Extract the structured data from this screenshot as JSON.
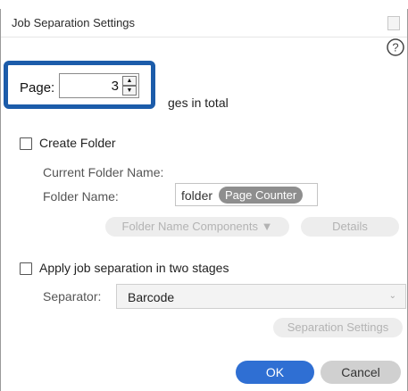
{
  "dialog": {
    "title": "Job Separation Settings",
    "help_icon": "question-circle-icon",
    "close_icon": "close-icon"
  },
  "page_spinner": {
    "label": "Page:",
    "value": "3",
    "up_icon": "triangle-up-icon",
    "down_icon": "triangle-down-icon"
  },
  "pages_total_row": {
    "label_visible": "ges in total"
  },
  "create_folder": {
    "label": "Create Folder",
    "checked": false,
    "current_folder_name_label": "Current Folder Name:",
    "folder_name_label": "Folder Name:",
    "folder_name_text": "folder",
    "folder_name_token": "Page Counter",
    "components_button": "Folder Name Components ▼",
    "details_button": "Details"
  },
  "two_stage": {
    "label": "Apply job separation in two stages",
    "checked": false,
    "separator_label": "Separator:",
    "separator_value": "Barcode",
    "separation_settings_button": "Separation Settings"
  },
  "footer": {
    "ok_label": "OK",
    "cancel_label": "Cancel"
  },
  "colors": {
    "highlight_border": "#1c5caa",
    "ok_button": "#2f6fd3",
    "cancel_button": "#d0d0d0",
    "token_pill": "#8e8e8e"
  }
}
